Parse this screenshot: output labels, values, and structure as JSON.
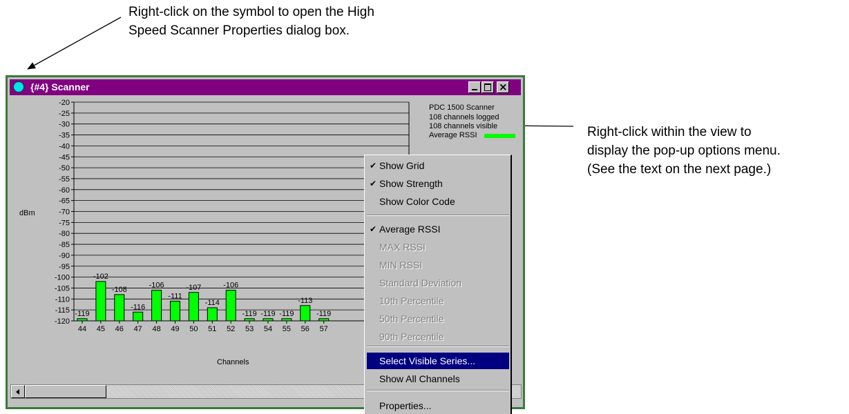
{
  "callouts": {
    "top": "Right-click on the symbol to open the High\nSpeed Scanner Properties dialog box.",
    "right": "Right-click within the view to\ndisplay the pop-up options menu.\n(See the text on the next page.)"
  },
  "window": {
    "title": "{#4} Scanner",
    "close_glyph": "×"
  },
  "legend": {
    "line1": "PDC 1500 Scanner",
    "line2": "108 channels logged",
    "line3": "108 channels visible",
    "series": "Average RSSI",
    "series_color": "#00ff00"
  },
  "chart_data": {
    "type": "bar",
    "ylabel": "dBm",
    "xlabel": "Channels",
    "ylim": [
      -120,
      -20
    ],
    "yticks": [
      -20,
      -25,
      -30,
      -35,
      -40,
      -45,
      -50,
      -55,
      -60,
      -65,
      -70,
      -75,
      -80,
      -85,
      -90,
      -95,
      -100,
      -105,
      -110,
      -115,
      -120
    ],
    "grid": true,
    "categories": [
      "44",
      "45",
      "46",
      "47",
      "48",
      "49",
      "50",
      "51",
      "52",
      "53",
      "54",
      "55",
      "56",
      "57"
    ],
    "series": [
      {
        "name": "Average RSSI",
        "color": "#00ff00",
        "values": [
          -119,
          -102,
          -108,
          -116,
          -106,
          -111,
          -107,
          -114,
          -106,
          -119,
          -119,
          -119,
          -113,
          -119
        ]
      }
    ]
  },
  "menu": {
    "items": [
      {
        "label": "Show Grid",
        "checked": "✔",
        "state": "enabled"
      },
      {
        "label": "Show Strength",
        "checked": "✔",
        "state": "enabled"
      },
      {
        "label": "Show Color Code",
        "checked": "",
        "state": "enabled"
      },
      {
        "label": "Average RSSI",
        "checked": "✔",
        "state": "enabled"
      },
      {
        "label": "MAX RSSI",
        "checked": "",
        "state": "disabled"
      },
      {
        "label": "MIN RSSI",
        "checked": "",
        "state": "disabled"
      },
      {
        "label": "Standard Deviation",
        "checked": "",
        "state": "disabled"
      },
      {
        "label": "10th Percentile",
        "checked": "",
        "state": "disabled"
      },
      {
        "label": "50th Percentile",
        "checked": "",
        "state": "disabled"
      },
      {
        "label": "90th Percentile",
        "checked": "",
        "state": "disabled"
      },
      {
        "label": "Select Visible Series...",
        "checked": "",
        "state": "selected"
      },
      {
        "label": "Show All Channels",
        "checked": "",
        "state": "enabled"
      },
      {
        "label": "Properties...",
        "checked": "",
        "state": "enabled"
      }
    ]
  }
}
